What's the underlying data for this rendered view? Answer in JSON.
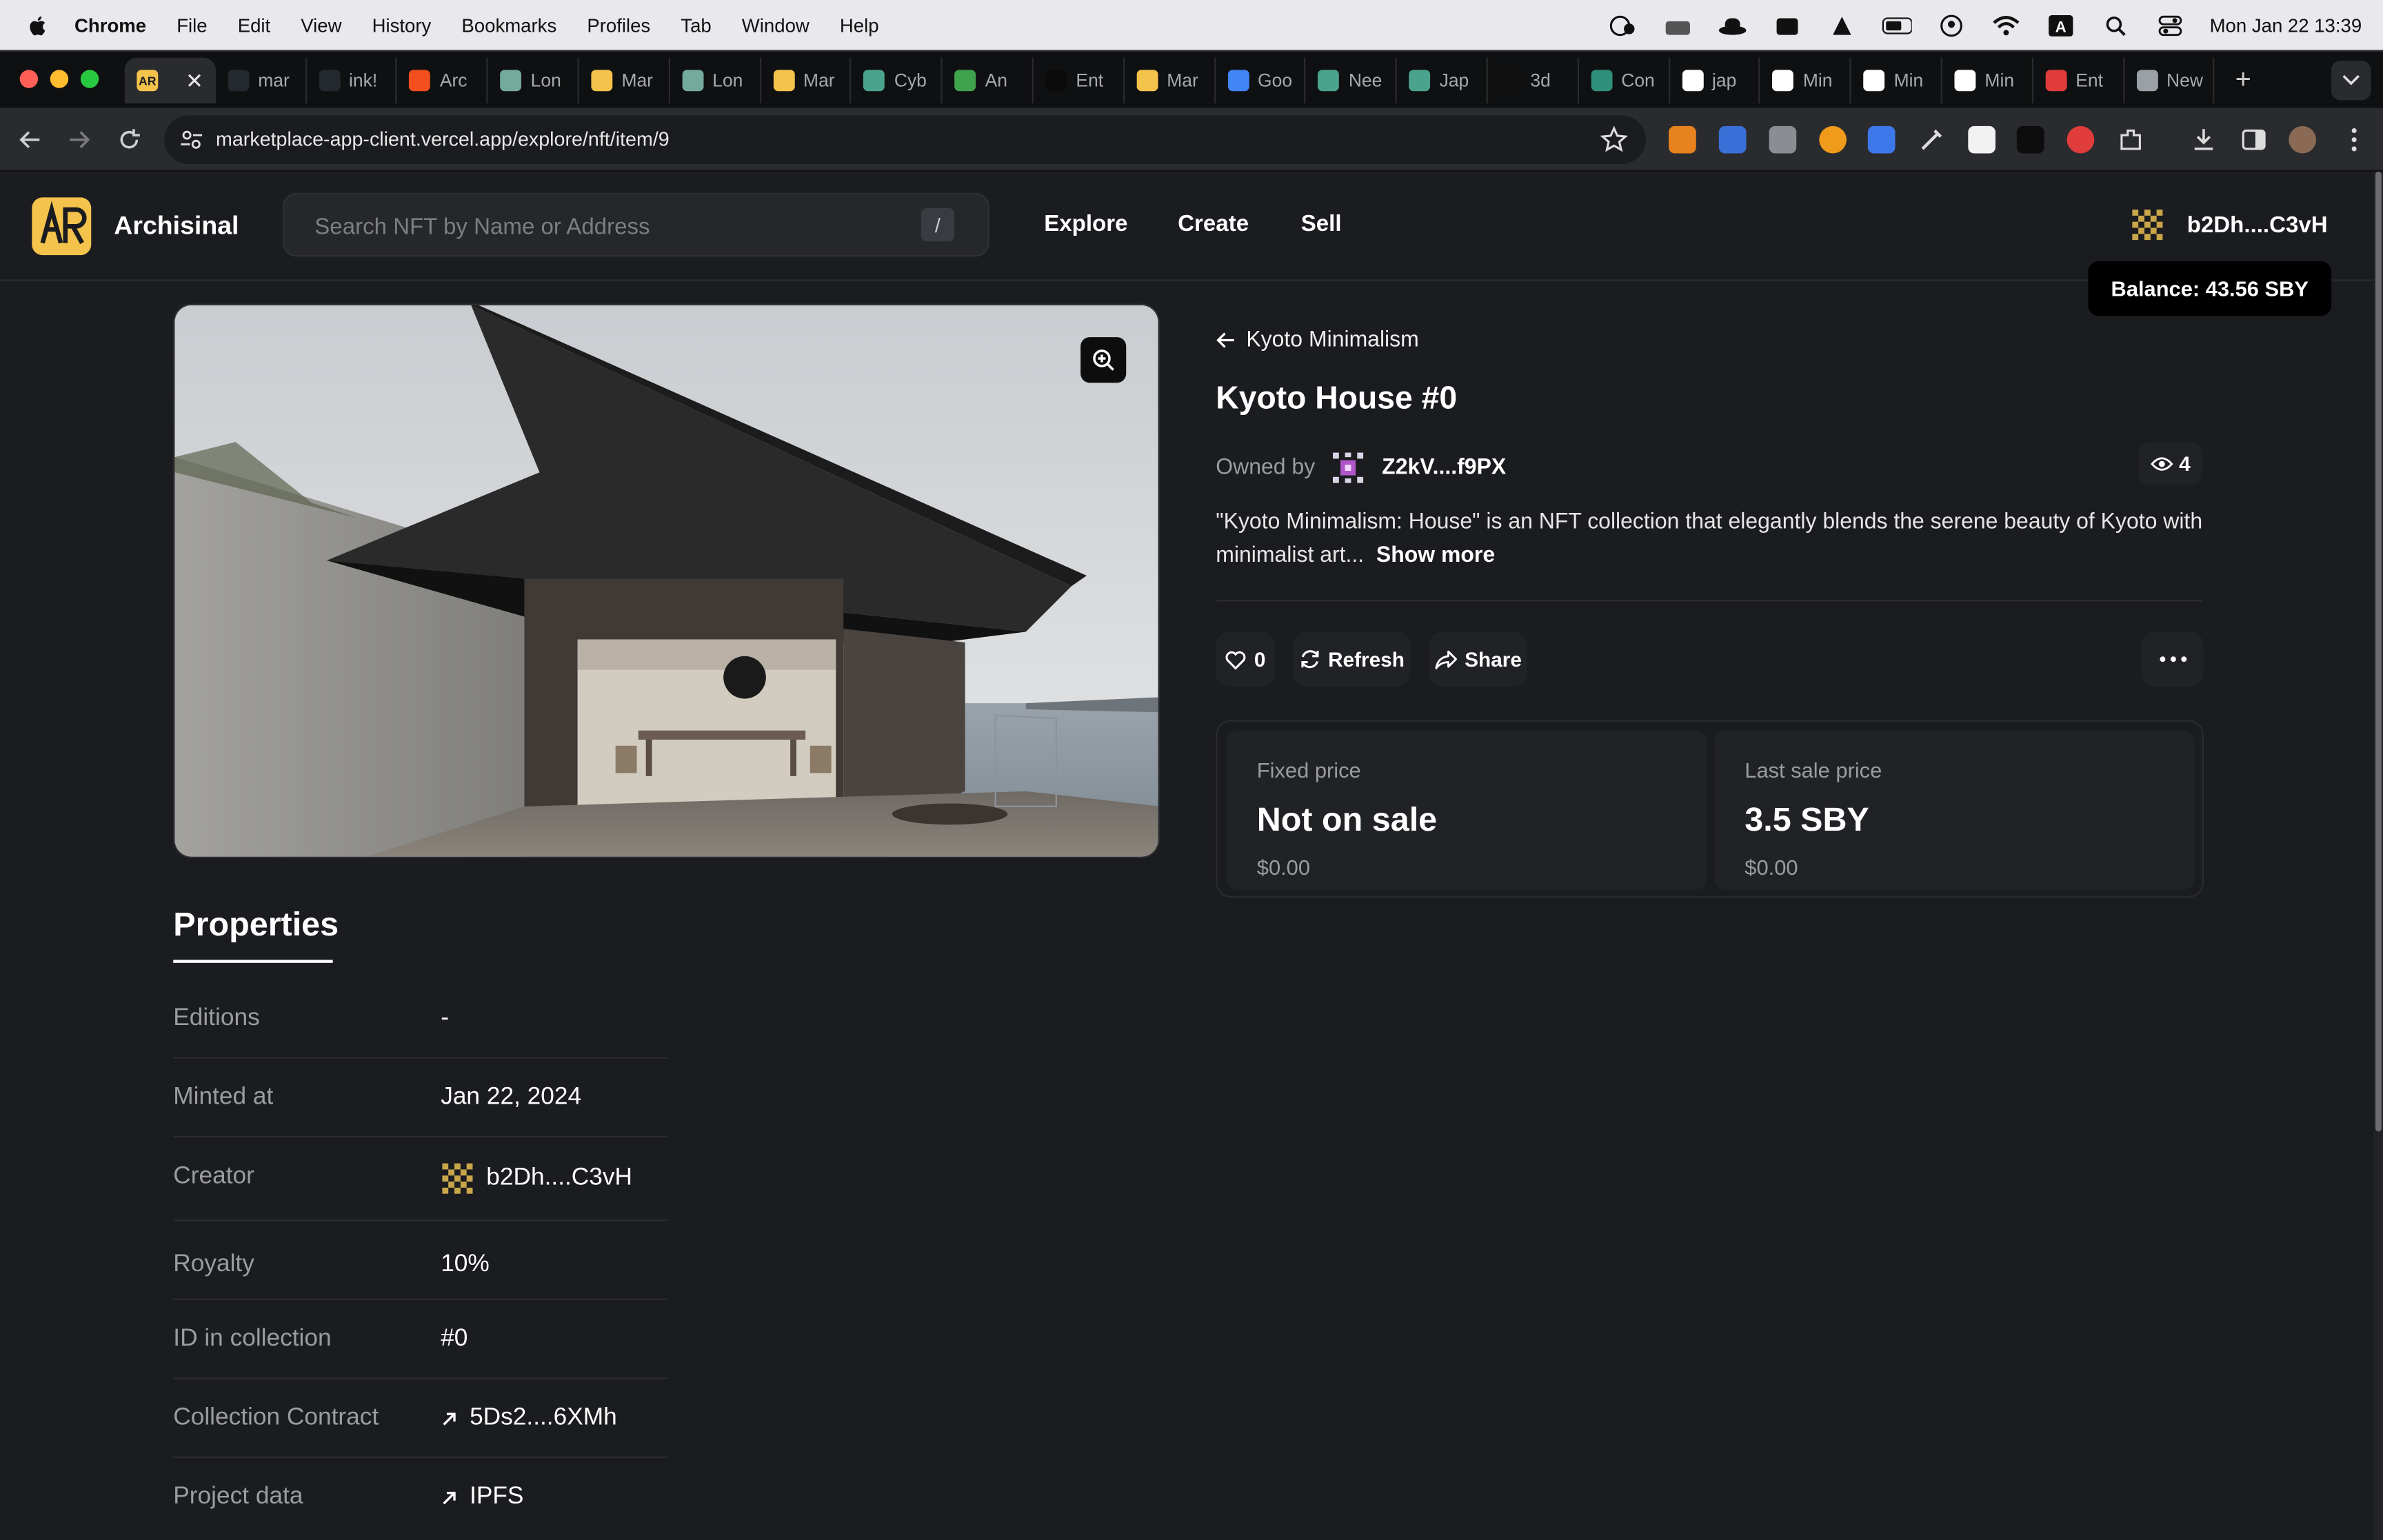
{
  "menubar": {
    "app_name": "Chrome",
    "items": [
      "File",
      "Edit",
      "View",
      "History",
      "Bookmarks",
      "Profiles",
      "Tab",
      "Window",
      "Help"
    ],
    "clock": "Mon Jan 22  13:39"
  },
  "browser": {
    "active_tab_icon": "archisinal-logo",
    "tabs": [
      {
        "label": "mar",
        "icon": "github-icon",
        "color": "#24292f"
      },
      {
        "label": "ink!",
        "icon": "github-icon",
        "color": "#24292f"
      },
      {
        "label": "Arc",
        "icon": "figma-icon",
        "color": "#f24e1e"
      },
      {
        "label": "Lon",
        "icon": "chatgpt-icon",
        "color": "#74aa9c"
      },
      {
        "label": "Mar",
        "icon": "archisinal-icon",
        "color": "#f4c34b"
      },
      {
        "label": "Lon",
        "icon": "chatgpt-icon",
        "color": "#74aa9c"
      },
      {
        "label": "Mar",
        "icon": "archisinal-icon",
        "color": "#f4c34b"
      },
      {
        "label": "Cyb",
        "icon": "doc-icon",
        "color": "#4aa38c"
      },
      {
        "label": "An",
        "icon": "leaf-icon",
        "color": "#3fa34d"
      },
      {
        "label": "Ent",
        "icon": "st-icon",
        "color": "#0b0b0b"
      },
      {
        "label": "Mar",
        "icon": "archisinal-icon",
        "color": "#f4c34b"
      },
      {
        "label": "Goo",
        "icon": "calendar-icon",
        "color": "#4285f4"
      },
      {
        "label": "Nee",
        "icon": "doc-icon",
        "color": "#4aa38c"
      },
      {
        "label": "Jap",
        "icon": "doc-icon",
        "color": "#4aa38c"
      },
      {
        "label": "3d",
        "icon": "is-icon",
        "color": "#111111"
      },
      {
        "label": "Con",
        "icon": "leaf-icon",
        "color": "#2f8f7a"
      },
      {
        "label": "jap",
        "icon": "google-icon",
        "color": "#ffffff"
      },
      {
        "label": "Min",
        "icon": "circle-icon",
        "color": "#ffffff"
      },
      {
        "label": "Min",
        "icon": "circle-icon",
        "color": "#ffffff"
      },
      {
        "label": "Min",
        "icon": "square-icon",
        "color": "#ffffff"
      },
      {
        "label": "Ent",
        "icon": "red-icon",
        "color": "#e03c3c"
      },
      {
        "label": "New",
        "icon": "chrome-icon",
        "color": "#9aa0a6"
      }
    ],
    "url": "marketplace-app-client.vercel.app/explore/nft/item/9"
  },
  "site": {
    "logo_text": "AR",
    "brand": "Archisinal",
    "search_placeholder": "Search NFT by Name or Address",
    "search_shortcut": "/",
    "nav": [
      "Explore",
      "Create",
      "Sell"
    ],
    "account_address": "b2Dh....C3vH",
    "balance_tooltip": "Balance: 43.56 SBY",
    "accent_color": "#f4c34b"
  },
  "nft": {
    "collection": "Kyoto Minimalism",
    "title": "Kyoto House #0",
    "owned_by_label": "Owned by",
    "owner": "Z2kV....f9PX",
    "views": "4",
    "description": "\"Kyoto Minimalism: House\" is an NFT collection that elegantly blends the serene beauty of Kyoto with minimalist art...",
    "show_more": "Show more",
    "likes": "0",
    "refresh_label": "Refresh",
    "share_label": "Share",
    "fixed_price_label": "Fixed price",
    "fixed_price_value": "Not on sale",
    "fixed_price_usd": "$0.00",
    "last_sale_label": "Last sale price",
    "last_sale_value": "3.5 SBY",
    "last_sale_usd": "$0.00"
  },
  "properties": {
    "title": "Properties",
    "rows": [
      {
        "key": "Editions",
        "value": "-"
      },
      {
        "key": "Minted at",
        "value": "Jan 22, 2024"
      },
      {
        "key": "Creator",
        "value": "b2Dh....C3vH"
      },
      {
        "key": "Royalty",
        "value": "10%"
      },
      {
        "key": "ID in collection",
        "value": "#0"
      },
      {
        "key": "Collection Contract",
        "value": "5Ds2....6XMh"
      },
      {
        "key": "Project data",
        "value": "IPFS"
      }
    ]
  }
}
